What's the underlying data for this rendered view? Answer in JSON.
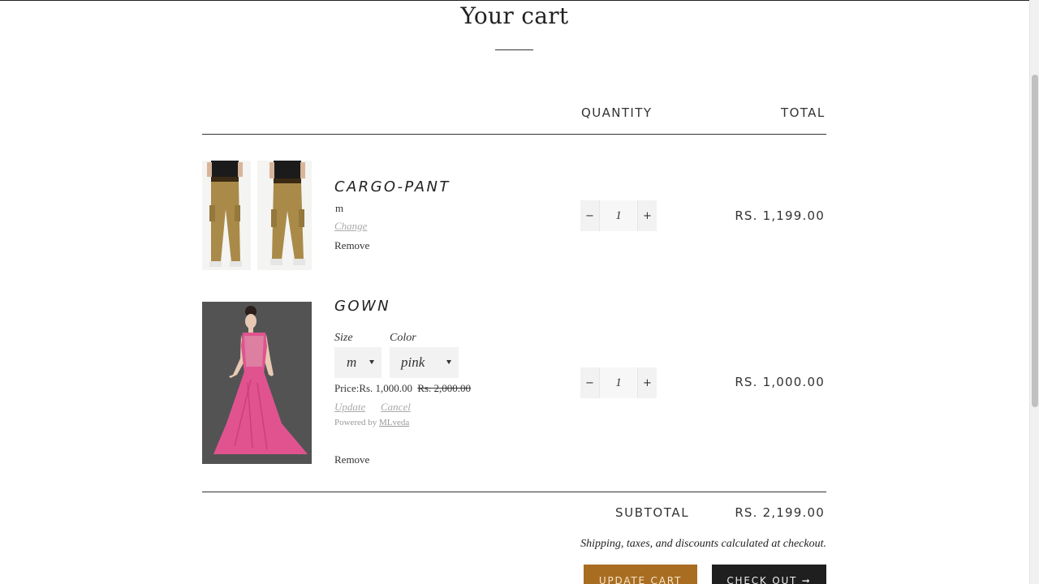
{
  "page": {
    "title": "Your cart"
  },
  "table": {
    "quantity_header": "QUANTITY",
    "total_header": "TOTAL"
  },
  "items": [
    {
      "name": "CARGO-PANT",
      "variant": "m",
      "change_label": "Change",
      "remove_label": "Remove",
      "quantity": "1",
      "total": "RS. 1,199.00",
      "image": "cargo-pant-photo"
    },
    {
      "name": "GOWN",
      "options": {
        "size_label": "Size",
        "size_value": "m",
        "color_label": "Color",
        "color_value": "pink"
      },
      "price_text": "Price:Rs. 1,000.00",
      "old_price": "Rs. 2,000.00",
      "update_label": "Update",
      "cancel_label": "Cancel",
      "powered_by": "Powered by",
      "powered_link": "MLveda",
      "remove_label": "Remove",
      "quantity": "1",
      "total": "RS. 1,000.00",
      "image": "pink-gown-photo"
    }
  ],
  "quantity_controls": {
    "minus": "−",
    "plus": "+"
  },
  "summary": {
    "subtotal_label": "SUBTOTAL",
    "subtotal_value": "RS. 2,199.00",
    "note": "Shipping, taxes, and discounts calculated at checkout."
  },
  "actions": {
    "update_cart": "UPDATE CART",
    "check_out": "CHECK OUT ➞"
  },
  "colors": {
    "update_button": "#a96d22",
    "checkout_button": "#1f1f1f",
    "gown_pink": "#e0538f"
  }
}
